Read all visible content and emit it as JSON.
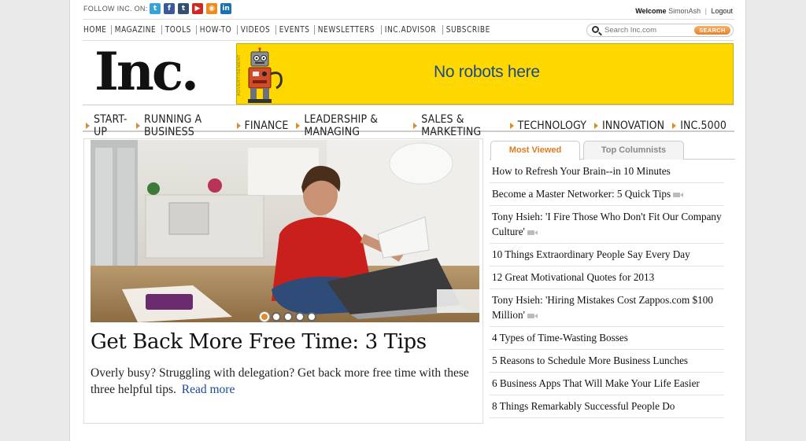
{
  "topbar": {
    "follow_label": "FOLLOW INC. ON:",
    "social_icons": [
      {
        "name": "twitter-icon",
        "glyph": "t",
        "color": "#3aa2d8"
      },
      {
        "name": "facebook-icon",
        "glyph": "f",
        "color": "#3b5998"
      },
      {
        "name": "tumblr-icon",
        "glyph": "t",
        "color": "#35506e"
      },
      {
        "name": "youtube-icon",
        "glyph": "▶",
        "color": "#cc2a22"
      },
      {
        "name": "rss-icon",
        "glyph": "◉",
        "color": "#ef8a1d"
      },
      {
        "name": "linkedin-icon",
        "glyph": "in",
        "color": "#1a73ac"
      }
    ],
    "welcome": "Welcome",
    "username": "SimonAsh",
    "separator": "|",
    "logout": "Logout"
  },
  "utilnav": {
    "items": [
      "HOME",
      "MAGAZINE",
      "TOOLS",
      "HOW-TO",
      "VIDEOS",
      "EVENTS",
      "NEWSLETTERS",
      "INC.ADVISOR",
      "SUBSCRIBE"
    ],
    "search_placeholder": "Search Inc.com",
    "search_button": "SEARCH"
  },
  "masthead": {
    "logo": "Inc.",
    "ad_label": "ADVERTISEMENT",
    "ad_text": "No robots here",
    "ad_color": "#ffd800"
  },
  "mainnav": {
    "items": [
      "START-UP",
      "RUNNING A BUSINESS",
      "FINANCE",
      "LEADERSHIP & MANAGING",
      "SALES & MARKETING",
      "TECHNOLOGY",
      "INNOVATION",
      "INC.5000"
    ]
  },
  "feature": {
    "headline": "Get Back More Free Time: 3 Tips",
    "blurb": "Overly busy? Struggling with delegation? Get back more free time with these three helpful tips.",
    "read_more": "Read more",
    "slide_count": 5,
    "active_slide": 1
  },
  "sidebar": {
    "tabs": [
      "Most Viewed",
      "Top Columnists"
    ],
    "active_tab": 0,
    "articles": [
      {
        "title": "How to Refresh Your Brain--in 10 Minutes",
        "video": false
      },
      {
        "title": "Become a Master Networker: 5 Quick Tips",
        "video": true
      },
      {
        "title": "Tony Hsieh: 'I Fire Those Who Don't Fit Our Company Culture'",
        "video": true
      },
      {
        "title": "10 Things Extraordinary People Say Every Day",
        "video": false
      },
      {
        "title": "12 Great Motivational Quotes for 2013",
        "video": false
      },
      {
        "title": "Tony Hsieh: 'Hiring Mistakes Cost Zappos.com $100 Million'",
        "video": true
      },
      {
        "title": "4 Types of Time-Wasting Bosses",
        "video": false
      },
      {
        "title": "5 Reasons to Schedule More Business Lunches",
        "video": false
      },
      {
        "title": "6 Business Apps That Will Make Your Life Easier",
        "video": false
      },
      {
        "title": "8 Things Remarkably Successful People Do",
        "video": false
      }
    ]
  },
  "colors": {
    "accent": "#e08a2d",
    "link": "#1a4a9a"
  }
}
